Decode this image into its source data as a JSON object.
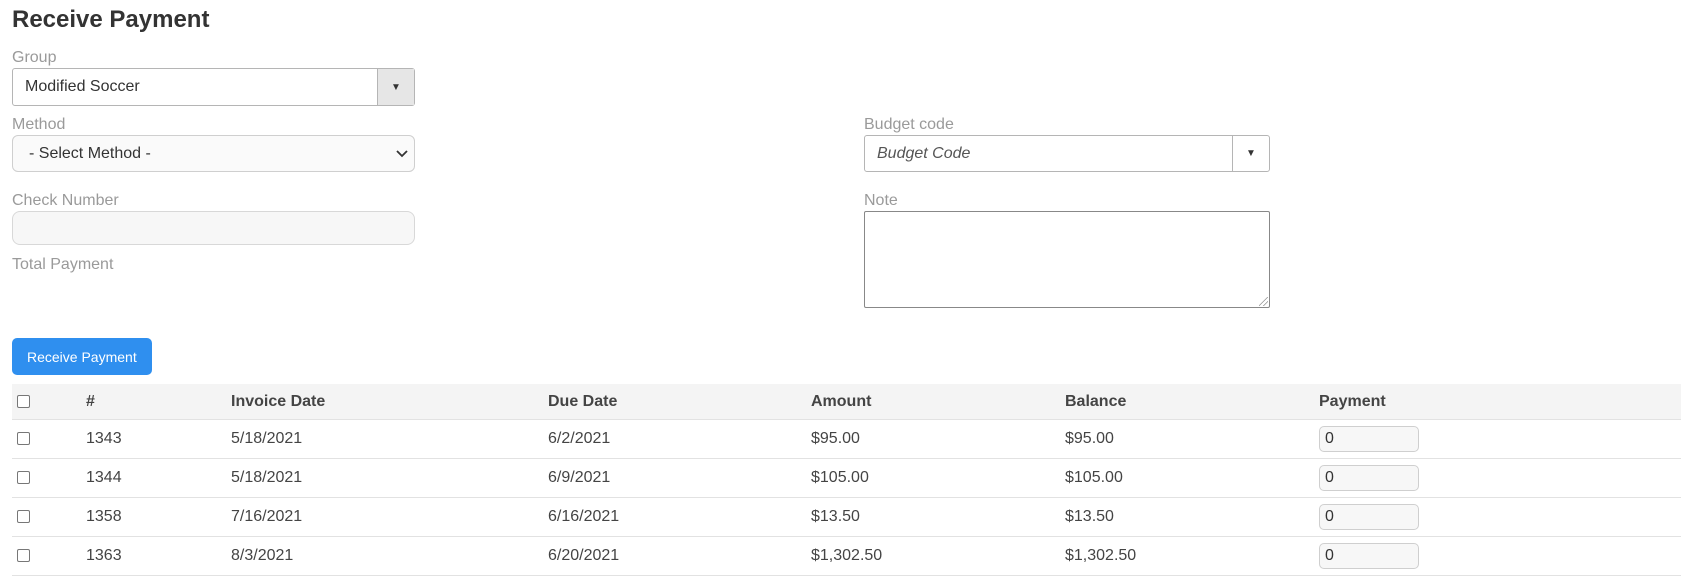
{
  "page": {
    "title": "Receive Payment"
  },
  "form": {
    "group": {
      "label": "Group",
      "value": "Modified Soccer",
      "button_glyph": "▼"
    },
    "method": {
      "label": "Method",
      "value": "- Select Method -",
      "chevron_glyph": "⌄"
    },
    "budget_code": {
      "label": "Budget code",
      "placeholder": "Budget Code",
      "button_glyph": "▼"
    },
    "check_number": {
      "label": "Check Number",
      "value": ""
    },
    "note": {
      "label": "Note",
      "value": ""
    },
    "total_payment": {
      "label": "Total Payment"
    },
    "submit_label": "Receive Payment"
  },
  "table": {
    "columns": [
      "#",
      "Invoice Date",
      "Due Date",
      "Amount",
      "Balance",
      "Payment"
    ],
    "rows": [
      {
        "number": "1343",
        "invoice_date": "5/18/2021",
        "due_date": "6/2/2021",
        "amount": "$95.00",
        "balance": "$95.00",
        "payment": "0"
      },
      {
        "number": "1344",
        "invoice_date": "5/18/2021",
        "due_date": "6/9/2021",
        "amount": "$105.00",
        "balance": "$105.00",
        "payment": "0"
      },
      {
        "number": "1358",
        "invoice_date": "7/16/2021",
        "due_date": "6/16/2021",
        "amount": "$13.50",
        "balance": "$13.50",
        "payment": "0"
      },
      {
        "number": "1363",
        "invoice_date": "8/3/2021",
        "due_date": "6/20/2021",
        "amount": "$1,302.50",
        "balance": "$1,302.50",
        "payment": "0"
      }
    ]
  },
  "colors": {
    "primary_button": "#2f8fef",
    "label_text": "#9a9a9a",
    "header_background": "#f4f4f4"
  }
}
